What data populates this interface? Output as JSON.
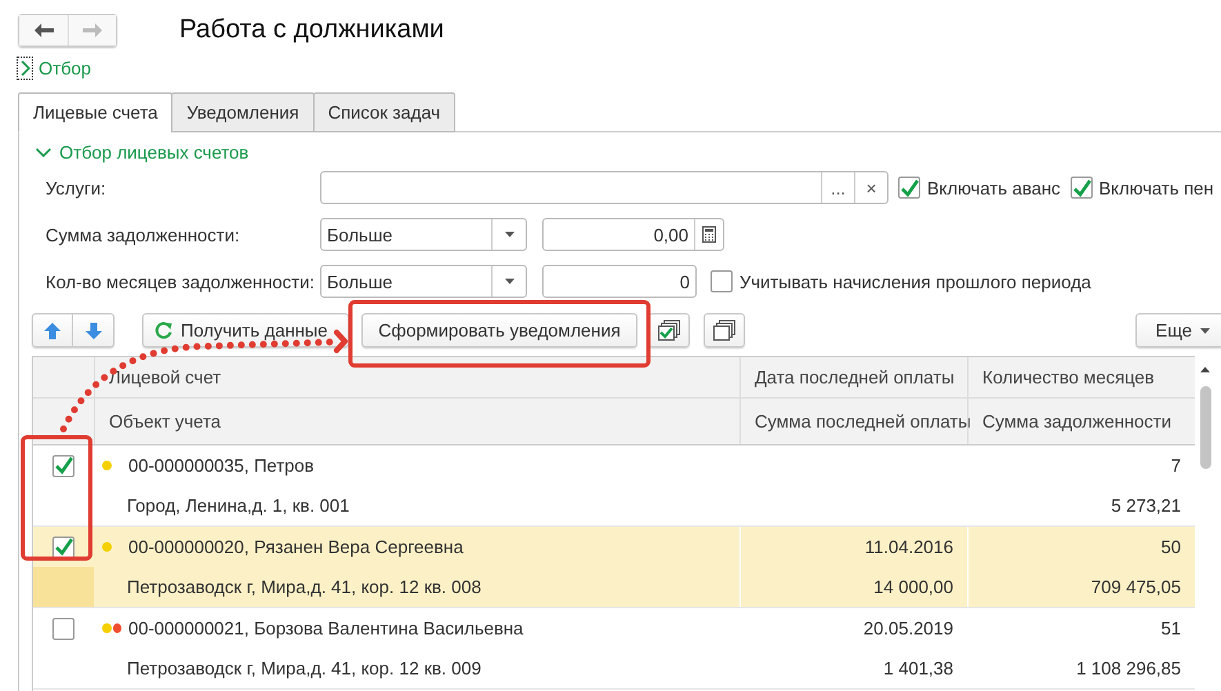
{
  "nav_buttons": [
    {
      "kind": "back",
      "disabled": false
    },
    {
      "kind": "forward",
      "disabled": true
    }
  ],
  "title": "Работа с должниками",
  "filter_link": {
    "label": "Отбор",
    "expanded": false
  },
  "tabs": [
    {
      "label": "Лицевые счета",
      "selected": true
    },
    {
      "label": "Уведомления",
      "selected": false
    },
    {
      "label": "Список задач",
      "selected": false
    }
  ],
  "section": {
    "label": "Отбор лицевых счетов",
    "expanded": true
  },
  "services": {
    "label": "Услуги:",
    "select_button": "...",
    "clear_button": "×"
  },
  "options": [
    {
      "label": "Включать аванс",
      "checked": true
    },
    {
      "label": "Включать пен",
      "checked": true
    }
  ],
  "debt_sum": {
    "label": "Сумма задолженности:",
    "condition": "Больше",
    "value": "0,00"
  },
  "debt_months": {
    "label": "Кол-во месяцев задолженности:",
    "condition": "Больше",
    "value": "0"
  },
  "prev_period": {
    "label": "Учитывать начисления прошлого периода",
    "checked": false
  },
  "toolbar": {
    "get_data": "Получить данные",
    "make_notices": "Сформировать уведомления",
    "more": "Еще"
  },
  "table": {
    "columns": [
      [
        "Лицевой счет",
        "Объект учета"
      ],
      [
        "Дата последней оплаты",
        "Сумма последней оплаты"
      ],
      [
        "Количество месяцев",
        "Сумма задолженности"
      ]
    ],
    "rows": [
      {
        "checked": true,
        "selected": false,
        "markers": [
          {
            "color": "#f5d000"
          }
        ],
        "account": "00-000000035, Петров",
        "object": "Город, Ленина,д. 1, кв. 001",
        "months": "7",
        "debt": "5 273,21"
      },
      {
        "checked": true,
        "selected": true,
        "markers": [
          {
            "color": "#f5d000"
          }
        ],
        "account": "00-000000020, Рязанен Вера Сергеевна",
        "object": "Петрозаводск г, Мира,д. 41, кор. 12 кв. 008",
        "last_date": "11.04.2016",
        "last_sum": "14 000,00",
        "months": "50",
        "debt": "709 475,05"
      },
      {
        "checked": false,
        "selected": false,
        "markers": [
          {
            "color": "#f5d000"
          },
          {
            "color": "#f04e2f"
          }
        ],
        "account": "00-000000021, Борзова Валентина Васильевна",
        "object": "Петрозаводск г, Мира,д. 41, кор. 12 кв. 009",
        "last_date": "20.05.2019",
        "last_sum": "1 401,38",
        "months": "51",
        "debt": "1 108 296,85"
      }
    ]
  }
}
